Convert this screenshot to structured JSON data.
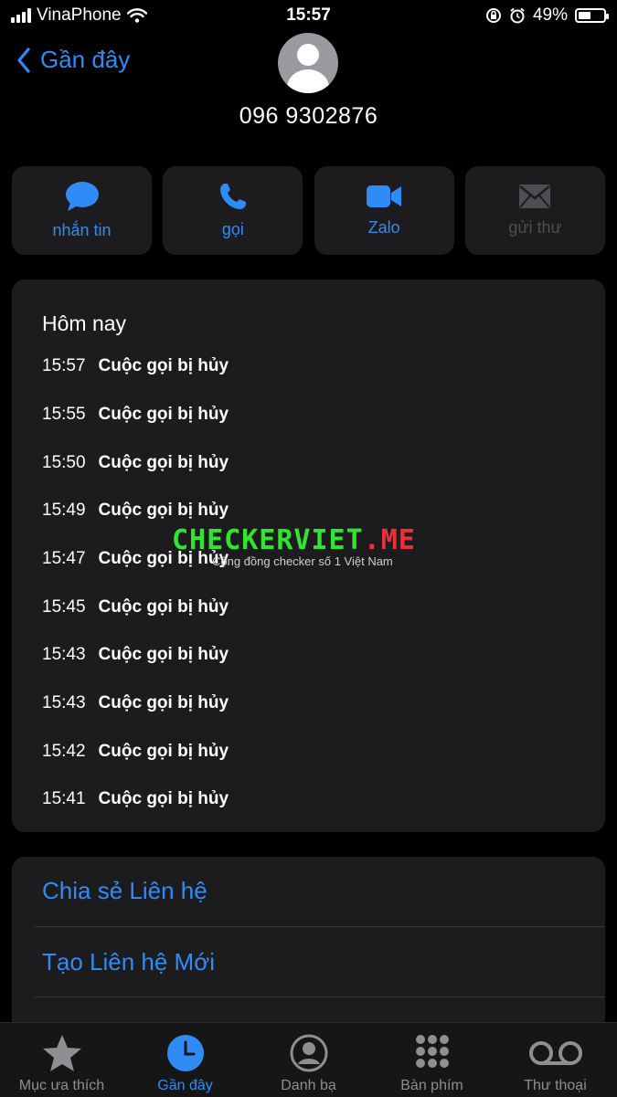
{
  "status_bar": {
    "carrier": "VinaPhone",
    "time": "15:57",
    "battery_percent": "49%",
    "battery_level": 0.49
  },
  "nav": {
    "back_label": "Gần đây"
  },
  "contact": {
    "phone_number": "096 9302876"
  },
  "actions": [
    {
      "label": "nhắn tin",
      "icon": "message-bubble-icon",
      "enabled": true
    },
    {
      "label": "gọi",
      "icon": "phone-icon",
      "enabled": true
    },
    {
      "label": "Zalo",
      "icon": "video-camera-icon",
      "enabled": true
    },
    {
      "label": "gửi thư",
      "icon": "envelope-icon",
      "enabled": false
    }
  ],
  "calls": {
    "section_title": "Hôm nay",
    "items": [
      {
        "time": "15:57",
        "status": "Cuộc gọi bị hủy"
      },
      {
        "time": "15:55",
        "status": "Cuộc gọi bị hủy"
      },
      {
        "time": "15:50",
        "status": "Cuộc gọi bị hủy"
      },
      {
        "time": "15:49",
        "status": "Cuộc gọi bị hủy"
      },
      {
        "time": "15:47",
        "status": "Cuộc gọi bị hủy"
      },
      {
        "time": "15:45",
        "status": "Cuộc gọi bị hủy"
      },
      {
        "time": "15:43",
        "status": "Cuộc gọi bị hủy"
      },
      {
        "time": "15:43",
        "status": "Cuộc gọi bị hủy"
      },
      {
        "time": "15:42",
        "status": "Cuộc gọi bị hủy"
      },
      {
        "time": "15:41",
        "status": "Cuộc gọi bị hủy"
      }
    ]
  },
  "watermark": {
    "brand_green": "CHECKERVIET",
    "brand_red": ".ME",
    "tagline": "Cộng đồng checker số 1 Việt Nam"
  },
  "options": {
    "share_contact": "Chia sẻ Liên hệ",
    "create_contact": "Tạo Liên hệ Mới"
  },
  "tabs": [
    {
      "label": "Mục ưa thích",
      "icon": "star-icon",
      "active": false
    },
    {
      "label": "Gần đây",
      "icon": "clock-icon",
      "active": true
    },
    {
      "label": "Danh bạ",
      "icon": "person-circle-icon",
      "active": false
    },
    {
      "label": "Bàn phím",
      "icon": "keypad-icon",
      "active": false
    },
    {
      "label": "Thư thoại",
      "icon": "voicemail-icon",
      "active": false
    }
  ],
  "colors": {
    "accent": "#2f8cf7",
    "background": "#000000",
    "card": "#1c1c1e",
    "disabled": "#4e4e52",
    "watermark_green": "#2fe62f",
    "watermark_red": "#e8323a"
  }
}
